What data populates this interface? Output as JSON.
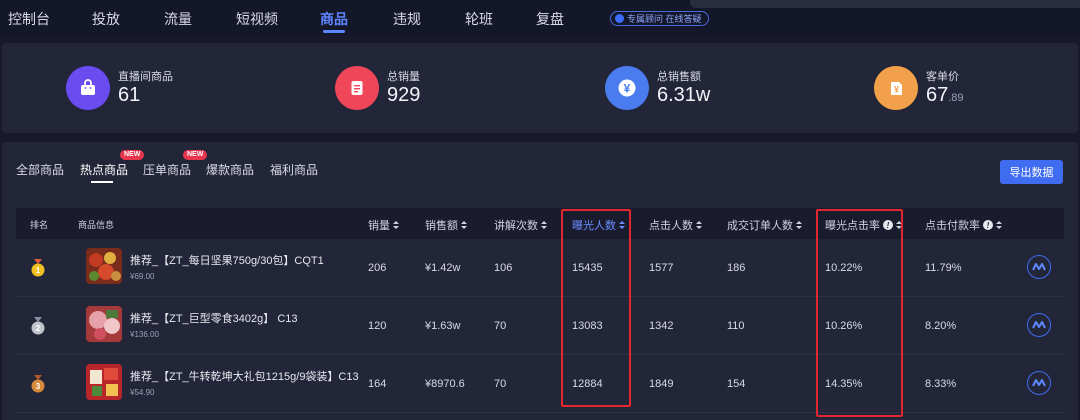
{
  "nav": {
    "items": [
      {
        "label": "控制台",
        "active": false
      },
      {
        "label": "投放",
        "active": false
      },
      {
        "label": "流量",
        "active": false
      },
      {
        "label": "短视频",
        "active": false
      },
      {
        "label": "商品",
        "active": true
      },
      {
        "label": "违规",
        "active": false
      },
      {
        "label": "轮班",
        "active": false
      },
      {
        "label": "复盘",
        "active": false
      }
    ],
    "consult_label": "专属顾问 在线答疑"
  },
  "stats": [
    {
      "label": "直播间商品",
      "value": "61",
      "value_suffix": "",
      "icon": "shopping-bag-icon",
      "color": "#6b4cf0"
    },
    {
      "label": "总销量",
      "value": "929",
      "value_suffix": "",
      "icon": "document-icon",
      "color": "#f0465a"
    },
    {
      "label": "总销售额",
      "value": "6.31w",
      "value_suffix": "",
      "icon": "yen-icon",
      "color": "#4a7cf0"
    },
    {
      "label": "客单价",
      "value": "67",
      "value_suffix": ".89",
      "icon": "price-tag-icon",
      "color": "#f3a04a"
    }
  ],
  "tabs": [
    {
      "label": "全部商品",
      "active": false,
      "badge": ""
    },
    {
      "label": "热点商品",
      "active": true,
      "badge": "NEW"
    },
    {
      "label": "压单商品",
      "active": false,
      "badge": "NEW"
    },
    {
      "label": "爆款商品",
      "active": false,
      "badge": ""
    },
    {
      "label": "福利商品",
      "active": false,
      "badge": ""
    }
  ],
  "export_label": "导出数据",
  "table": {
    "columns": {
      "rank": "排名",
      "info": "商品信息",
      "sales": "销量",
      "amount": "销售额",
      "explain": "讲解次数",
      "exposure": "曝光人数",
      "clicks": "点击人数",
      "orders": "成交订单人数",
      "ctr": "曝光点击率",
      "pay_rate": "点击付款率"
    },
    "rows": [
      {
        "rank": 1,
        "name": "推荐_【ZT_每日坚果750g/30包】CQT1",
        "price": "¥69.00",
        "sales": "206",
        "amount": "¥1.42w",
        "explain": "106",
        "exposure": "15435",
        "clicks": "1577",
        "orders": "186",
        "ctr": "10.22%",
        "pay_rate": "11.79%"
      },
      {
        "rank": 2,
        "name": "推荐_【ZT_巨型零食3402g】 C13",
        "price": "¥136.00",
        "sales": "120",
        "amount": "¥1.63w",
        "explain": "70",
        "exposure": "13083",
        "clicks": "1342",
        "orders": "110",
        "ctr": "10.26%",
        "pay_rate": "8.20%"
      },
      {
        "rank": 3,
        "name": "推荐_【ZT_牛转乾坤大礼包1215g/9袋装】C13",
        "price": "¥54.90",
        "sales": "164",
        "amount": "¥8970.6",
        "explain": "70",
        "exposure": "12884",
        "clicks": "1849",
        "orders": "154",
        "ctr": "14.35%",
        "pay_rate": "8.33%"
      }
    ]
  },
  "colors": {
    "accent": "#3f6cf0",
    "highlight_box": "#e0262e",
    "gold": "#f0c020",
    "silver": "#c0c4cc",
    "bronze": "#d68a3c"
  }
}
